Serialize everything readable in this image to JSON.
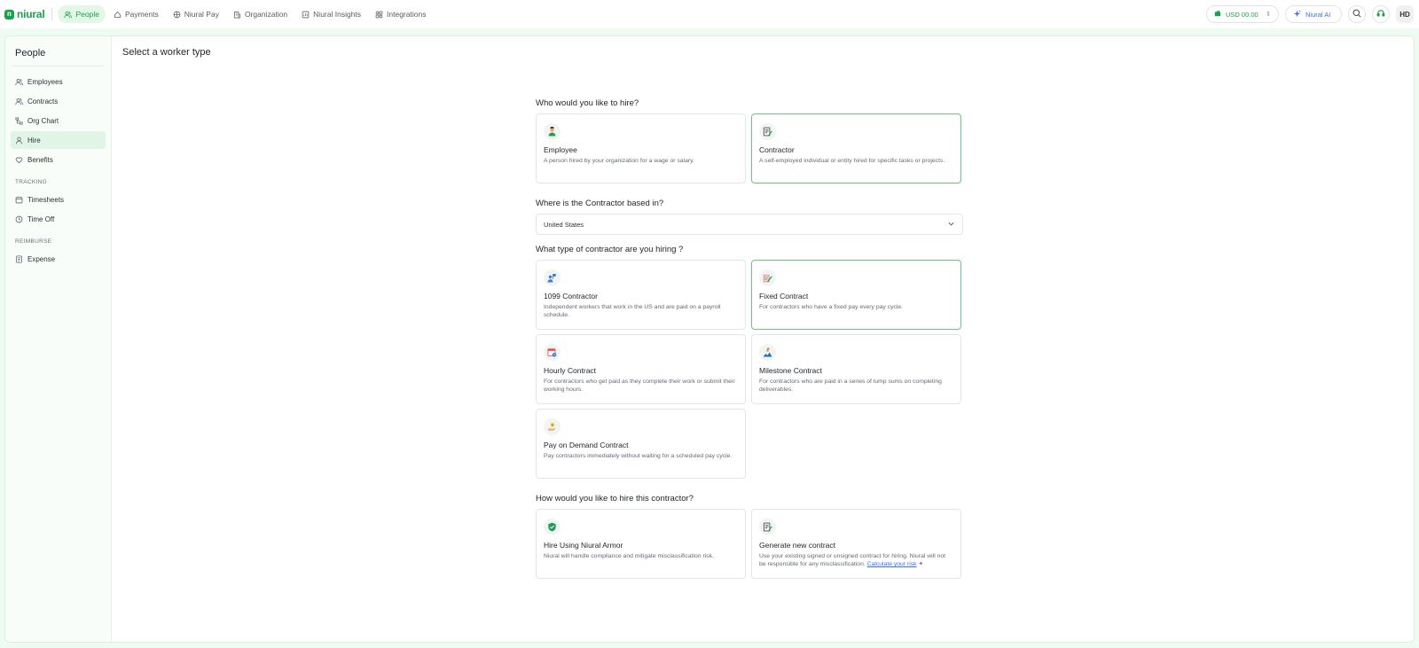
{
  "brand": {
    "name": "niural",
    "mark": "n"
  },
  "nav": [
    {
      "label": "People",
      "icon": "people-icon",
      "active": true
    },
    {
      "label": "Payments",
      "icon": "payments-icon",
      "active": false
    },
    {
      "label": "Niural Pay",
      "icon": "niural-pay-icon",
      "active": false
    },
    {
      "label": "Organization",
      "icon": "organization-icon",
      "active": false
    },
    {
      "label": "Niural Insights",
      "icon": "insights-icon",
      "active": false
    },
    {
      "label": "Integrations",
      "icon": "integrations-icon",
      "active": false
    }
  ],
  "topright": {
    "currency": "USD 00.00",
    "ai_label": "Niural AI",
    "avatar": "HD"
  },
  "sidebar": {
    "title": "People",
    "items": [
      {
        "label": "Employees",
        "icon": "employees-icon",
        "active": false
      },
      {
        "label": "Contracts",
        "icon": "contracts-icon",
        "active": false
      },
      {
        "label": "Org Chart",
        "icon": "org-chart-icon",
        "active": false
      },
      {
        "label": "Hire",
        "icon": "hire-icon",
        "active": true
      },
      {
        "label": "Benefits",
        "icon": "heart-icon",
        "active": false
      }
    ],
    "tracking_title": "TRACKING",
    "tracking": [
      {
        "label": "Timesheets",
        "icon": "timesheets-icon"
      },
      {
        "label": "Time Off",
        "icon": "time-off-icon"
      }
    ],
    "reimburse_title": "REIMBURSE",
    "reimburse": [
      {
        "label": "Expense",
        "icon": "expense-icon"
      }
    ]
  },
  "page": {
    "title": "Select a worker type"
  },
  "form": {
    "q1": "Who would you like to hire?",
    "worker_types": [
      {
        "title": "Employee",
        "desc": "A person hired by your organization for a wage or salary.",
        "icon": "employee-icon",
        "selected": false
      },
      {
        "title": "Contractor",
        "desc": "A self-employed individual or entity hired for specific tasks or projects.",
        "icon": "contractor-icon",
        "selected": true
      }
    ],
    "q2": "Where is the Contractor based in?",
    "country": "United States",
    "q3": "What type of contractor are you hiring ?",
    "contract_types": [
      {
        "title": "1099 Contractor",
        "desc": "Independent workers that work in the US and are paid on a payroll schedule.",
        "icon": "1099-contractor-icon",
        "selected": false
      },
      {
        "title": "Fixed Contract",
        "desc": "For contractors who have a fixed pay every pay cycle.",
        "icon": "fixed-contract-icon",
        "selected": true
      },
      {
        "title": "Hourly Contract",
        "desc": "For contractors who get paid as they complete their work or submit their working hours.",
        "icon": "hourly-contract-icon",
        "selected": false
      },
      {
        "title": "Milestone Contract",
        "desc": "For contractors who are paid in a series of lump sums on completing deliverables.",
        "icon": "milestone-contract-icon",
        "selected": false
      },
      {
        "title": "Pay on Demand Contract",
        "desc": "Pay contractors immediately without waiting for a scheduled pay cycle.",
        "icon": "pay-on-demand-icon",
        "selected": false
      }
    ],
    "q4": "How would you like to hire this contractor?",
    "hire_methods": [
      {
        "title": "Hire Using Niural Armor",
        "desc": "Niural will handle compliance and mitigate misclassification risk.",
        "icon": "shield-check-icon"
      },
      {
        "title": "Generate new contract",
        "desc": "Use your existing signed or unsigned contract for hiring. Niural will not be responsible for any misclassification.",
        "link": "Calculate your risk",
        "icon": "generate-contract-icon"
      }
    ]
  },
  "colors": {
    "brand_green": "#18a34a",
    "selected_border": "#6cc283",
    "link_blue": "#3b6cf0"
  }
}
